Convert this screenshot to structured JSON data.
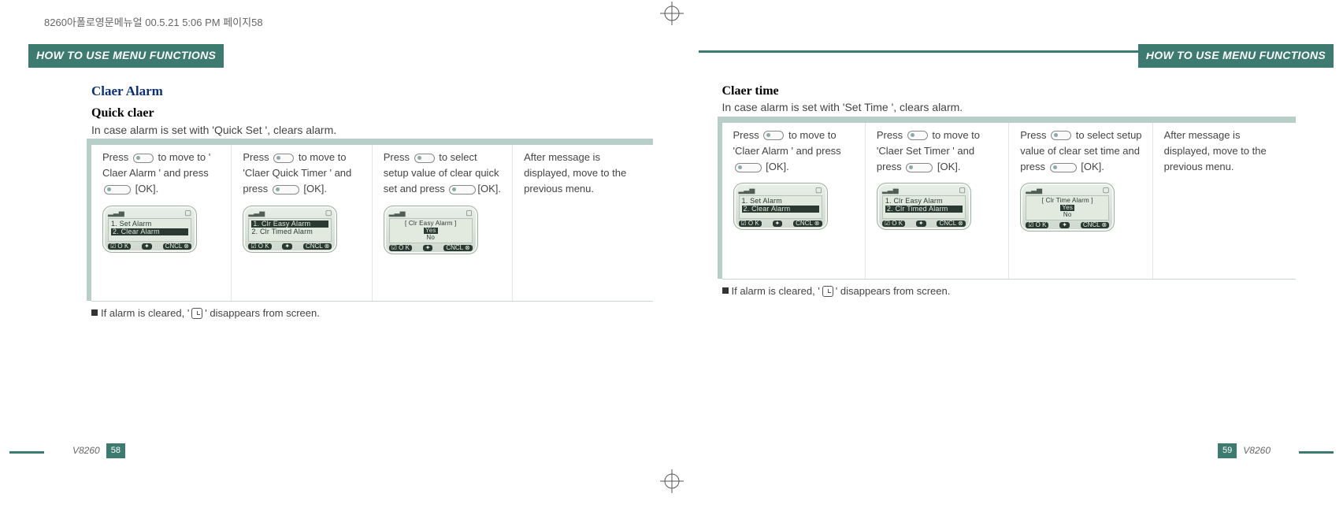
{
  "header_note": "8260아폴로영문메뉴얼   00.5.21 5:06 PM  페이지58",
  "tab_title": "HOW TO USE MENU FUNCTIONS",
  "left": {
    "section": "Claer Alarm",
    "subtitle": "Quick claer",
    "intro_a": "In case alarm is set with  ",
    "intro_q": "'Quick Set '",
    "intro_b": ", clears alarm.",
    "steps": [
      {
        "t1": "Press ",
        "t2": " to move to  ",
        "t3": "' Claer Alarm '",
        "t4": " and press ",
        "t5": " [OK].",
        "lcd": {
          "rows": [
            "1.  Set  Alarm",
            "2.  Clear  Alarm"
          ],
          "hl": 1
        }
      },
      {
        "t1": "Press ",
        "t2": " to move to ",
        "t3": "'Claer Quick Timer '",
        "t4": " and press ",
        "t5": " [OK].",
        "lcd": {
          "rows": [
            "1.  Clr  Easy  Alarm",
            "2.  Clr  Timed Alarm"
          ],
          "hl": 0
        }
      },
      {
        "t1": "Press ",
        "t2": " to select setup value of clear quick set and press ",
        "t5": "[OK].",
        "lcd": {
          "title": "[ Clr  Easy Alarm ]",
          "rows": [
            "Yes",
            "No"
          ],
          "hl": 0,
          "centered": true
        }
      },
      {
        "plain": "After message is displayed, move to the previous menu."
      }
    ],
    "note_a": "If alarm is cleared, '",
    "note_b": "' disappears from screen.",
    "model": "V8260",
    "page_no": "58"
  },
  "right": {
    "subtitle": "Claer time",
    "intro_a": "In case alarm is set with  ",
    "intro_q": "'Set Time '",
    "intro_b": ", clears alarm.",
    "steps": [
      {
        "t1": "Press ",
        "t2": " to move to ",
        "t3": "'Claer Alarm '",
        "t4": "  and press ",
        "t5": " [OK].",
        "lcd": {
          "rows": [
            "1.  Set  Alarm",
            "2.  Clear  Alarm"
          ],
          "hl": 1
        }
      },
      {
        "t1": "Press ",
        "t2": " to move to ",
        "t3": "'Claer Set Timer '",
        "t4": " and press ",
        "t5": " [OK].",
        "lcd": {
          "rows": [
            "1.  Clr  Easy  Alarm",
            "2.  Clr  Timed Alarm"
          ],
          "hl": 1
        }
      },
      {
        "t1": "Press ",
        "t2": " to select setup value of clear set time and press ",
        "t5": " [OK].",
        "lcd": {
          "title": "[ Clr  Time  Alarm ]",
          "rows": [
            "Yes",
            "No"
          ],
          "hl": 0,
          "centered": true
        }
      },
      {
        "plain": "After message is displayed, move to the previous menu."
      }
    ],
    "note_a": "If alarm is cleared, '",
    "note_b": "' disappears from screen.",
    "model": "V8260",
    "page_no": "59"
  },
  "lcd_footer": {
    "ok": "O K",
    "cncl": "CNCL"
  },
  "lcd_top": {
    "sig": "▂▃▅",
    "bat": "▢"
  }
}
